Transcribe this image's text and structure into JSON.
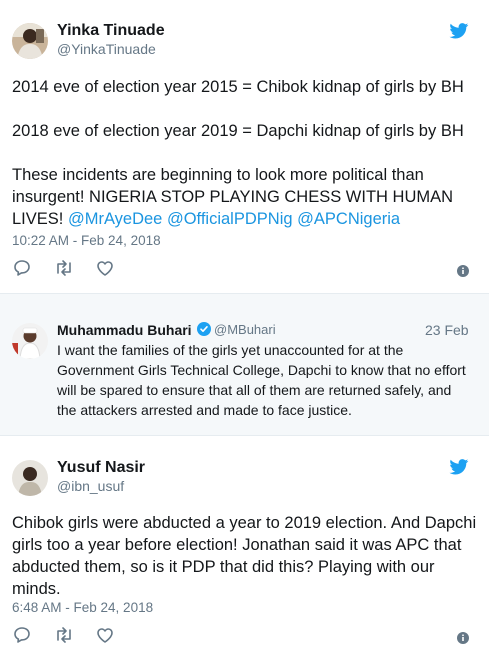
{
  "tweet1": {
    "author_name": "Yinka Tinuade",
    "handle": "@YinkaTinuade",
    "paragraph1": "2014 eve of election year 2015 = Chibok kidnap of girls by BH",
    "paragraph2": "2018 eve of election year 2019 = Dapchi kidnap of girls by BH",
    "paragraph3_text": "These incidents are beginning to look more political than insurgent! NIGERIA STOP PLAYING CHESS WITH HUMAN LIVES!",
    "mentions": [
      "@MrAyeDee",
      "@OfficialPDPNig",
      "@APCNigeria"
    ],
    "timestamp": "10:22 AM - Feb 24, 2018"
  },
  "quoted": {
    "author_name": "Muhammadu Buhari",
    "handle": "@MBuhari",
    "date": "23 Feb",
    "text": "I want the families of the girls yet unaccounted for at the Government Girls Technical College, Dapchi to know that no effort will be spared to ensure that all of them are returned safely, and the attackers arrested and made to face justice."
  },
  "tweet2": {
    "author_name": "Yusuf Nasir",
    "handle": "@ibn_usuf",
    "text": "Chibok girls were abducted a year to 2019 election. And Dapchi girls too a year before election! Jonathan said it was APC that abducted them, so is it PDP that did this? Playing with our minds.",
    "timestamp": "6:48 AM - Feb 24, 2018"
  },
  "colors": {
    "twitter_blue": "#1da1f2",
    "link_blue": "#1b95e0",
    "text": "#14171a",
    "muted": "#657786",
    "icon_gray": "#657786",
    "quoted_bg": "#f5f8fa",
    "divider": "#e6ecf0"
  },
  "icons": [
    "twitter-bird-icon",
    "reply-icon",
    "retweet-icon",
    "like-icon",
    "info-icon",
    "verified-badge-icon"
  ]
}
